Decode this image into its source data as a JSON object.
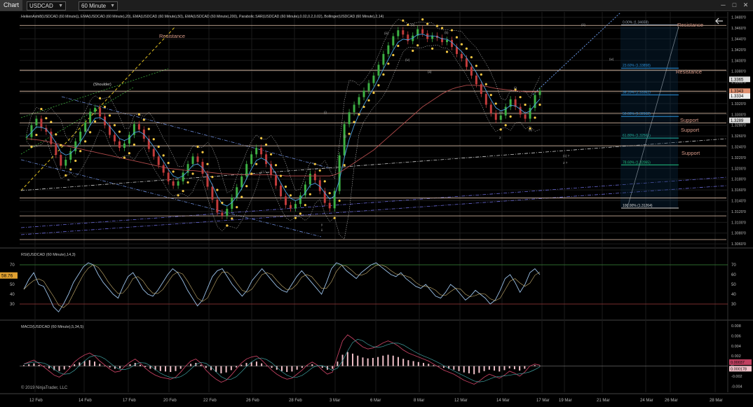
{
  "toolbar": {
    "chart_label": "Chart",
    "instrument": "USDCAD",
    "interval": "60 Minute",
    "window_buttons": [
      "─",
      "□",
      "✕"
    ]
  },
  "colors": {
    "background": "#000000",
    "grid": "#1c1c1c",
    "price_line": "#f2c0a8",
    "level_line": "#e8c8b0",
    "fib_line": "#2a8fd8",
    "resistance_text": "#d89a88",
    "support_text": "#d89a88",
    "ema20": "#4aa0e0",
    "ema200": "#b04a4a",
    "psar": "#f5c842",
    "bollinger": "#dddddd",
    "bull_candle": "#3cb043",
    "bear_candle": "#c23b3b",
    "rsi_line": "#9ac0e8",
    "macd_line": "#c04060",
    "macd_hist": "#f0c0c8"
  },
  "chart_data": [
    {
      "type": "line",
      "title": "HeikenAshi8(USDCAD (60 Minute)), EMA(USDCAD (60 Minute),20), EMA(USDCAD (60 Minute),50), EMA(USDCAD (60 Minute),200), Parabolic SAR(USDCAD (60 Minute),0.02,0.2,0.02), Bollinger(USDCAD (60 Minute),2,14)",
      "y_ticks": [
        "1.3480'0",
        "1.3460'0",
        "1.3440'0",
        "1.3420'0",
        "1.3400'0",
        "1.3380'0",
        "1.3360'0",
        "1.3340'0",
        "1.3320'0",
        "1.3300'0",
        "1.3280'0",
        "1.3260'0",
        "1.3240'0",
        "1.3220'0",
        "1.3200'0",
        "1.3180'0",
        "1.3160'0",
        "1.3140'0",
        "1.3120'0",
        "1.3100'0",
        "1.3080'0",
        "1.3060'0"
      ],
      "ylim": [
        1.3055,
        1.349
      ],
      "series": [
        {
          "values": [
            1.3258,
            1.328,
            1.3292,
            1.3275,
            1.3268,
            1.3245,
            1.3225,
            1.3205,
            1.3216,
            1.3232,
            1.325,
            1.3268,
            1.3285,
            1.3305,
            1.3312,
            1.3296,
            1.328,
            1.3262,
            1.325,
            1.3238,
            1.3246,
            1.3262,
            1.3282,
            1.3272,
            1.3255,
            1.3236,
            1.3222,
            1.3206,
            1.3192,
            1.3176,
            1.3168,
            1.3176,
            1.3192,
            1.3208,
            1.3222,
            1.3212,
            1.319,
            1.3166,
            1.3142,
            1.3118,
            1.3112,
            1.3125,
            1.3146,
            1.3165,
            1.3185,
            1.3208,
            1.3226,
            1.3238,
            1.3226,
            1.3208,
            1.3188,
            1.3168,
            1.3148,
            1.3132,
            1.3126,
            1.3134,
            1.315,
            1.317,
            1.319,
            1.3178,
            1.3158,
            1.3136,
            1.3126,
            1.3158,
            1.3224,
            1.3282,
            1.3304,
            1.3318,
            1.3332,
            1.3344,
            1.3358,
            1.3372,
            1.3392,
            1.3412,
            1.3428,
            1.3445,
            1.3456,
            1.3448,
            1.3436,
            1.3446,
            1.3458,
            1.345,
            1.344,
            1.3446,
            1.3442,
            1.3434,
            1.3438,
            1.3425,
            1.3412,
            1.3404,
            1.3388,
            1.3372,
            1.3356,
            1.3338,
            1.3318,
            1.3302,
            1.329,
            1.3298,
            1.3314,
            1.3328,
            1.3314,
            1.33,
            1.3292,
            1.3312,
            1.3336,
            1.3344
          ]
        }
      ],
      "ema200": [
        1.3255,
        1.3254,
        1.3253,
        1.3252,
        1.325,
        1.3248,
        1.3246,
        1.3244,
        1.3242,
        1.324,
        1.3238,
        1.3236,
        1.3234,
        1.3232,
        1.323,
        1.3228,
        1.3226,
        1.3224,
        1.3222,
        1.322,
        1.3218,
        1.3216,
        1.3214,
        1.3212,
        1.321,
        1.3208,
        1.3206,
        1.3204,
        1.3202,
        1.32,
        1.3199,
        1.3198,
        1.3197,
        1.3196,
        1.3196,
        1.3195,
        1.3194,
        1.3193,
        1.3192,
        1.3191,
        1.319,
        1.319,
        1.3189,
        1.3189,
        1.3188,
        1.3188,
        1.3188,
        1.3188,
        1.3188,
        1.3188,
        1.3188,
        1.3187,
        1.3187,
        1.3186,
        1.3186,
        1.3186,
        1.3186,
        1.3186,
        1.3186,
        1.3186,
        1.3186,
        1.3186,
        1.3186,
        1.3188,
        1.3192,
        1.3198,
        1.3204,
        1.321,
        1.3216,
        1.3222,
        1.3228,
        1.3234,
        1.3242,
        1.325,
        1.3258,
        1.3266,
        1.3274,
        1.3282,
        1.329,
        1.3298,
        1.3306,
        1.3314,
        1.332,
        1.3326,
        1.3332,
        1.3338,
        1.3343,
        1.3347,
        1.335,
        1.3352,
        1.3354,
        1.3354,
        1.3354,
        1.3353,
        1.3352,
        1.335,
        1.3348,
        1.3347,
        1.3346,
        1.3345,
        1.3344,
        1.3343,
        1.3342,
        1.3342,
        1.3342,
        1.3342
      ],
      "price_labels": {
        "ask": "1.3365",
        "last": "1.3343",
        "bid": "1.3334",
        "sar": "1.3289"
      },
      "levels": [
        {
          "value": 1.3465,
          "color": "#e8c8b0"
        },
        {
          "value": 1.3382,
          "color": "#e8c8b0"
        },
        {
          "value": 1.3343,
          "color": "#e8c8b0"
        },
        {
          "value": 1.3302,
          "color": "#e8c8b0"
        },
        {
          "value": 1.3284,
          "color": "#e8c8b0"
        },
        {
          "value": 1.3242,
          "color": "#e8c8b0"
        },
        {
          "value": 1.3145,
          "color": "#e8c8b0"
        },
        {
          "value": 1.3112,
          "color": "#e8c8b0"
        },
        {
          "value": 1.3068,
          "color": "#e8c8b0"
        }
      ],
      "fib": [
        {
          "label": "0.00% (1.34659)",
          "value": 1.34659,
          "color": "#9aa8b8"
        },
        {
          "label": "23.60% (1.33858)",
          "value": 1.33858,
          "color": "#2a8fd8"
        },
        {
          "label": "38.20% (1.33362)",
          "value": 1.33362,
          "color": "#2a8fd8"
        },
        {
          "label": "50.00% (1.32962)",
          "value": 1.32962,
          "color": "#2a8fd8"
        },
        {
          "label": "61.80% (1.32561)",
          "value": 1.32561,
          "color": "#20b0a0"
        },
        {
          "label": "78.60% (1.32065)",
          "value": 1.32065,
          "color": "#20c080"
        },
        {
          "label": "100.00% (1.31264)",
          "value": 1.31264,
          "color": "#dddddd"
        }
      ],
      "annotations": {
        "resistance": [
          "Resistance",
          "Resistance",
          "Resistance"
        ],
        "support": [
          "Support",
          "Support",
          "Support"
        ],
        "shoulder": "(Shoulder)",
        "wave_labels": [
          "(iii)",
          "(iv)",
          "(v)",
          "(a)",
          "(b)",
          "(iii)",
          "(ii)",
          "(i)",
          "(w)",
          "(c) ?",
          "2 ?",
          "w",
          "y",
          "ii",
          "(ii)",
          "2",
          "(i)",
          "(i)",
          "(x)"
        ]
      }
    },
    {
      "type": "line",
      "title": "RSI(USDCAD (60 Minute),14,3)",
      "ylim": [
        15,
        85
      ],
      "y_ticks": [
        "70",
        "60",
        "50",
        "40",
        "30"
      ],
      "current": "58.76",
      "overbought": 70,
      "oversold": 30,
      "series": [
        {
          "values": [
            45,
            55,
            62,
            50,
            48,
            38,
            27,
            22,
            30,
            40,
            52,
            60,
            68,
            72,
            70,
            60,
            52,
            46,
            40,
            36,
            48,
            58,
            62,
            54,
            45,
            40,
            38,
            44,
            52,
            60,
            66,
            62,
            54,
            44,
            36,
            28,
            34,
            46,
            58,
            64,
            66,
            58,
            50,
            44,
            38,
            44,
            54,
            60,
            66,
            60,
            54,
            48,
            44,
            42,
            50,
            58,
            64,
            58,
            52,
            46,
            40,
            52,
            66,
            72,
            70,
            64,
            60,
            56,
            62,
            66,
            70,
            72,
            68,
            64,
            60,
            58,
            62,
            56,
            52,
            48,
            46,
            50,
            44,
            38,
            36,
            42,
            50,
            46,
            40,
            34,
            38,
            44,
            40,
            36,
            30,
            34,
            44,
            56,
            60,
            52,
            42,
            50,
            62,
            66,
            60
          ]
        }
      ]
    },
    {
      "type": "line",
      "title": "MACD(USDCAD (60 Minute),5,34,5)",
      "ylim": [
        -0.0052,
        0.0087
      ],
      "y_ticks": [
        "0.008",
        "0.006",
        "0.004",
        "0.002",
        "0",
        "-0.002",
        "-0.004"
      ],
      "current": [
        "0.00037",
        "0.000178"
      ],
      "series": [
        {
          "values": [
            0.0004,
            0.0008,
            0.0012,
            0.0005,
            -0.0002,
            -0.001,
            -0.0018,
            -0.0022,
            -0.0015,
            -0.0005,
            0.0008,
            0.0016,
            0.0022,
            0.0026,
            0.002,
            0.001,
            0.0002,
            -0.0006,
            -0.0012,
            -0.001,
            0.0,
            0.0008,
            0.0014,
            0.0006,
            -0.0004,
            -0.0012,
            -0.0018,
            -0.0022,
            -0.0024,
            -0.0026,
            -0.0022,
            -0.0012,
            0.0,
            0.001,
            0.0014,
            0.0006,
            -0.0008,
            -0.0018,
            -0.0026,
            -0.0032,
            -0.0028,
            -0.0018,
            -0.0006,
            0.0006,
            0.0014,
            0.0018,
            0.002,
            0.0012,
            0.0002,
            -0.0008,
            -0.0016,
            -0.0022,
            -0.0026,
            -0.0024,
            -0.0016,
            -0.0008,
            0.0002,
            0.0008,
            0.0002,
            -0.0008,
            -0.0016,
            -0.0012,
            0.002,
            0.005,
            0.0062,
            0.0055,
            0.0046,
            0.0038,
            0.0034,
            0.0036,
            0.004,
            0.0046,
            0.005,
            0.0046,
            0.004,
            0.0032,
            0.0026,
            0.0022,
            0.0018,
            0.0014,
            0.001,
            0.0004,
            -0.0002,
            -0.0008,
            -0.0012,
            -0.0016,
            -0.0022,
            -0.0028,
            -0.0032,
            -0.0036,
            -0.003,
            -0.0022,
            -0.0016,
            -0.002,
            -0.0024,
            -0.0018,
            -0.001,
            -0.0014,
            -0.002,
            -0.0012,
            0.0,
            0.0004,
            0.0002
          ]
        }
      ]
    }
  ],
  "x_axis": {
    "labels": [
      "12 Feb",
      "14 Feb",
      "17 Feb",
      "20 Feb",
      "22 Feb",
      "26 Feb",
      "28 Feb",
      "3 Mar",
      "6 Mar",
      "8 Mar",
      "12 Mar",
      "14 Mar",
      "17 Mar",
      "19 Mar",
      "21 Mar",
      "24 Mar",
      "26 Mar",
      "28 Mar"
    ]
  },
  "copyright": "© 2019 NinjaTrader, LLC"
}
